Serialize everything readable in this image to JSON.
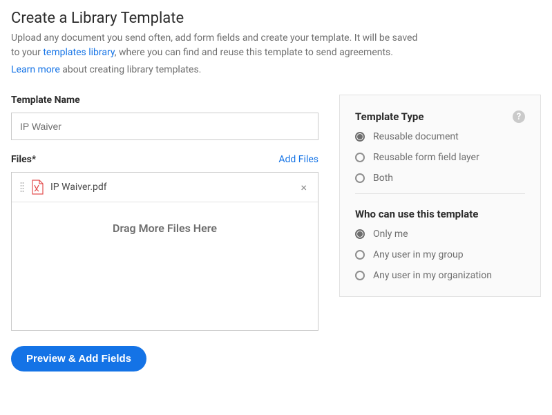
{
  "header": {
    "title": "Create a Library Template",
    "sub_prefix": "Upload any document you send often, add form fields and create your template. It will be saved to your ",
    "sub_link": "templates library",
    "sub_suffix": ", where you can find and reuse this template to send agreements.",
    "learn_more_link": "Learn more",
    "learn_more_suffix": " about creating library templates."
  },
  "template_name": {
    "label": "Template Name",
    "value": "IP Waiver"
  },
  "files": {
    "label": "Files",
    "required_mark": "*",
    "add_files": "Add Files",
    "items": [
      {
        "name": "IP Waiver.pdf"
      }
    ],
    "drag_text": "Drag More Files Here"
  },
  "template_type": {
    "title": "Template Type",
    "options": [
      {
        "label": "Reusable document",
        "selected": true
      },
      {
        "label": "Reusable form field layer",
        "selected": false
      },
      {
        "label": "Both",
        "selected": false
      }
    ]
  },
  "permissions": {
    "title": "Who can use this template",
    "options": [
      {
        "label": "Only me",
        "selected": true
      },
      {
        "label": "Any user in my group",
        "selected": false
      },
      {
        "label": "Any user in my organization",
        "selected": false
      }
    ]
  },
  "actions": {
    "primary": "Preview & Add Fields"
  },
  "help": {
    "glyph": "?"
  }
}
